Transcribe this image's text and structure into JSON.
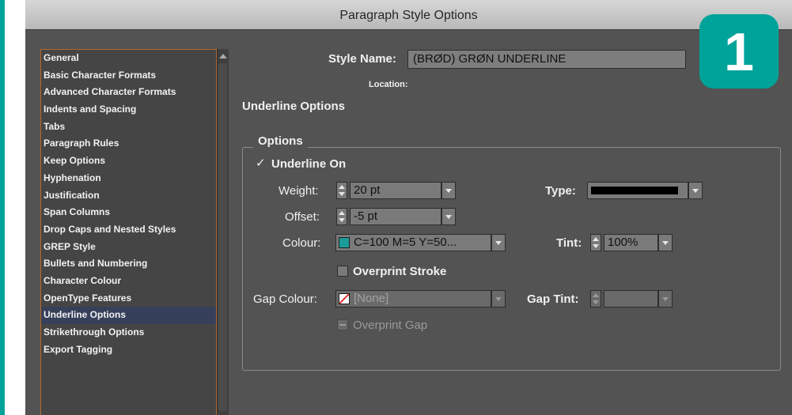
{
  "window": {
    "title": "Paragraph Style Options"
  },
  "badge": {
    "number": "1",
    "color": "#00a39a"
  },
  "sidebar": {
    "items": [
      {
        "label": "General"
      },
      {
        "label": "Basic Character Formats"
      },
      {
        "label": "Advanced Character Formats"
      },
      {
        "label": "Indents and Spacing"
      },
      {
        "label": "Tabs"
      },
      {
        "label": "Paragraph Rules"
      },
      {
        "label": "Keep Options"
      },
      {
        "label": "Hyphenation"
      },
      {
        "label": "Justification"
      },
      {
        "label": "Span Columns"
      },
      {
        "label": "Drop Caps and Nested Styles"
      },
      {
        "label": "GREP Style"
      },
      {
        "label": "Bullets and Numbering"
      },
      {
        "label": "Character Colour"
      },
      {
        "label": "OpenType Features"
      },
      {
        "label": "Underline Options"
      },
      {
        "label": "Strikethrough Options"
      },
      {
        "label": "Export Tagging"
      }
    ],
    "selected": "Underline Options"
  },
  "header": {
    "style_name_label": "Style Name:",
    "style_name_value": "(BRØD) GRØN UNDERLINE",
    "location_label": "Location:",
    "section_title": "Underline Options"
  },
  "options": {
    "legend": "Options",
    "underline_on_label": "Underline On",
    "underline_on_checked": true,
    "weight": {
      "label": "Weight:",
      "value": "20 pt"
    },
    "offset": {
      "label": "Offset:",
      "value": "-5 pt"
    },
    "colour": {
      "label": "Colour:",
      "value": "C=100 M=5 Y=50...",
      "swatch": "#1b9c9a"
    },
    "type": {
      "label": "Type:",
      "value": "solid-line"
    },
    "tint": {
      "label": "Tint:",
      "value": "100%"
    },
    "overprint_stroke": {
      "label": "Overprint Stroke",
      "checked": false
    },
    "gap_colour": {
      "label": "Gap Colour:",
      "value": "[None]"
    },
    "gap_tint": {
      "label": "Gap Tint:",
      "value": ""
    },
    "overprint_gap": {
      "label": "Overprint Gap"
    }
  }
}
